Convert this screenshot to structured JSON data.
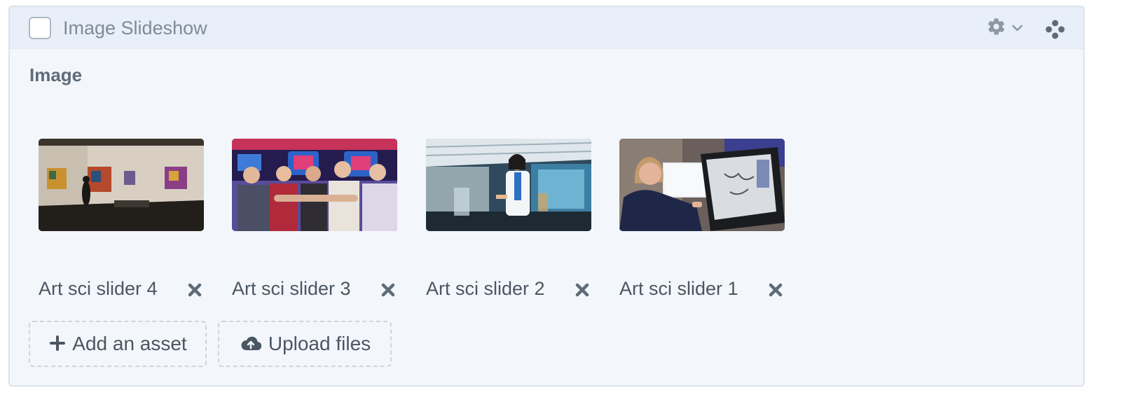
{
  "block": {
    "title": "Image Slideshow"
  },
  "field": {
    "label": "Image"
  },
  "assets": [
    {
      "title": "Art sci slider 4",
      "image": "gallery-visitor"
    },
    {
      "title": "Art sci slider 3",
      "image": "students-rings"
    },
    {
      "title": "Art sci slider 2",
      "image": "lab-scientist"
    },
    {
      "title": "Art sci slider 1",
      "image": "drawing-tablet"
    }
  ],
  "actions": {
    "add_label": "Add an asset",
    "upload_label": "Upload files"
  },
  "icons": {
    "settings": "gear-icon",
    "dropdown": "chevron-down-icon",
    "drag": "move-handle-icon",
    "remove": "close-icon",
    "add": "plus-icon",
    "upload": "cloud-upload-icon"
  },
  "colors": {
    "panel_bg": "#f3f7fc",
    "header_bg": "#e8eff8",
    "text": "#4b5663",
    "muted": "#808b98"
  }
}
